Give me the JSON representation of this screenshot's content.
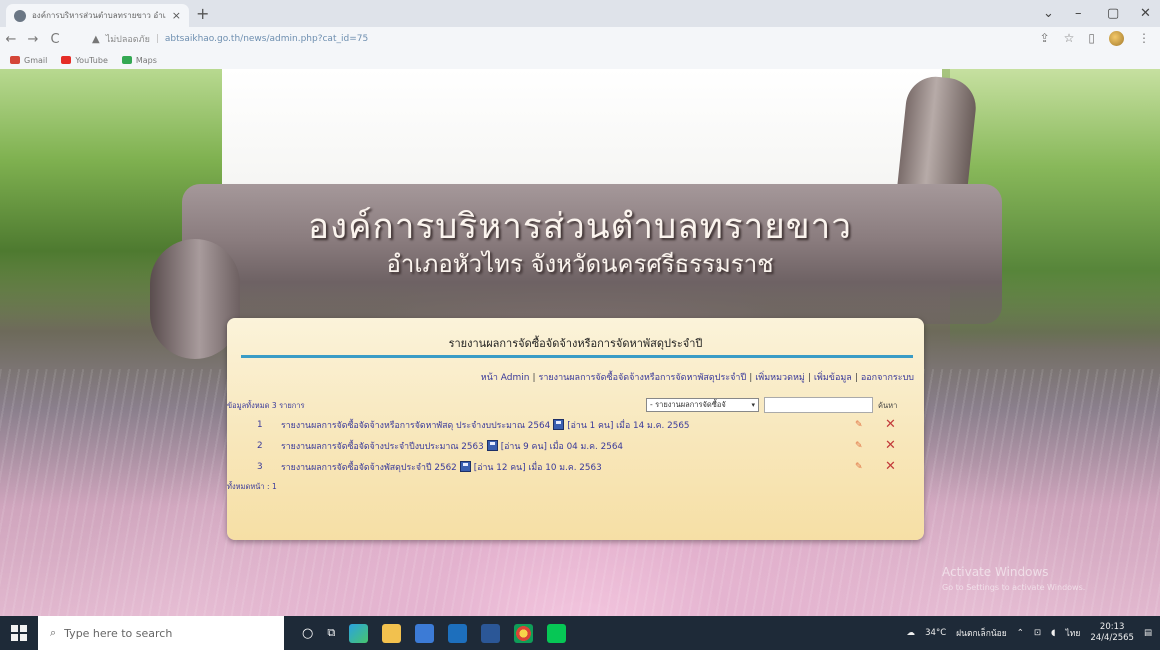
{
  "browser": {
    "tab_title": "องค์การบริหารส่วนตำบลทรายขาว อำเภ...",
    "tab_close": "×",
    "new_tab": "+",
    "window_controls": {
      "minimize": "–",
      "maximize": "▢",
      "close": "✕",
      "chevron": "⌄"
    },
    "nav": {
      "back": "←",
      "forward": "→",
      "reload": "C"
    },
    "security_label": "ไม่ปลอดภัย",
    "url": "abtsaikhao.go.th/news/admin.php?cat_id=75",
    "bookmarks": [
      {
        "label": "Gmail",
        "color": "#d44638"
      },
      {
        "label": "YouTube",
        "color": "#e52d27"
      },
      {
        "label": "Maps",
        "color": "#34a853"
      }
    ]
  },
  "site": {
    "title": "องค์การบริหารส่วนตำบลทรายขาว",
    "subtitle": "อำเภอหัวไทร จังหวัดนครศรีธรรมราช"
  },
  "panel": {
    "heading": "รายงานผลการจัดซื้อจัดจ้างหรือการจัดหาพัสดุประจำปี",
    "nav_links": [
      "หน้า Admin",
      "รายงานผลการจัดซื้อจัดจ้างหรือการจัดหาพัสดุประจำปี",
      "เพิ่มหมวดหมู่",
      "เพิ่มข้อมูล",
      "ออกจากระบบ"
    ],
    "count_text": "ข้อมูลทั้งหมด 3 รายการ",
    "category_select": "- รายงานผลการจัดซื้อจั",
    "search_button": "ค้นหา",
    "rows": [
      {
        "num": "1",
        "title": "รายงานผลการจัดซื้อจัดจ้างหรือการจัดหาพัสดุ ประจำงบประมาณ 2564",
        "meta": "[อ่าน 1 คน] เมื่อ 14 ม.ค. 2565"
      },
      {
        "num": "2",
        "title": "รายงานผลการจัดซื้อจัดจ้างประจำปีงบประมาณ 2563",
        "meta": "[อ่าน 9 คน] เมื่อ 04 ม.ค. 2564"
      },
      {
        "num": "3",
        "title": "รายงานผลการจัดซื้อจัดจ้างพัสดุประจำปี 2562",
        "meta": "[อ่าน 12 คน] เมื่อ 10 ม.ค. 2563"
      }
    ],
    "pages_text": "ทั้งหมดหน้า : 1"
  },
  "watermark": {
    "line1": "Activate Windows",
    "line2": "Go to Settings to activate Windows."
  },
  "taskbar": {
    "search_placeholder": "Type here to search",
    "weather": "34°C",
    "weather_desc": "ฝนตกเล็กน้อย",
    "language": "ไทย",
    "time": "20:13",
    "date": "24/4/2565"
  }
}
